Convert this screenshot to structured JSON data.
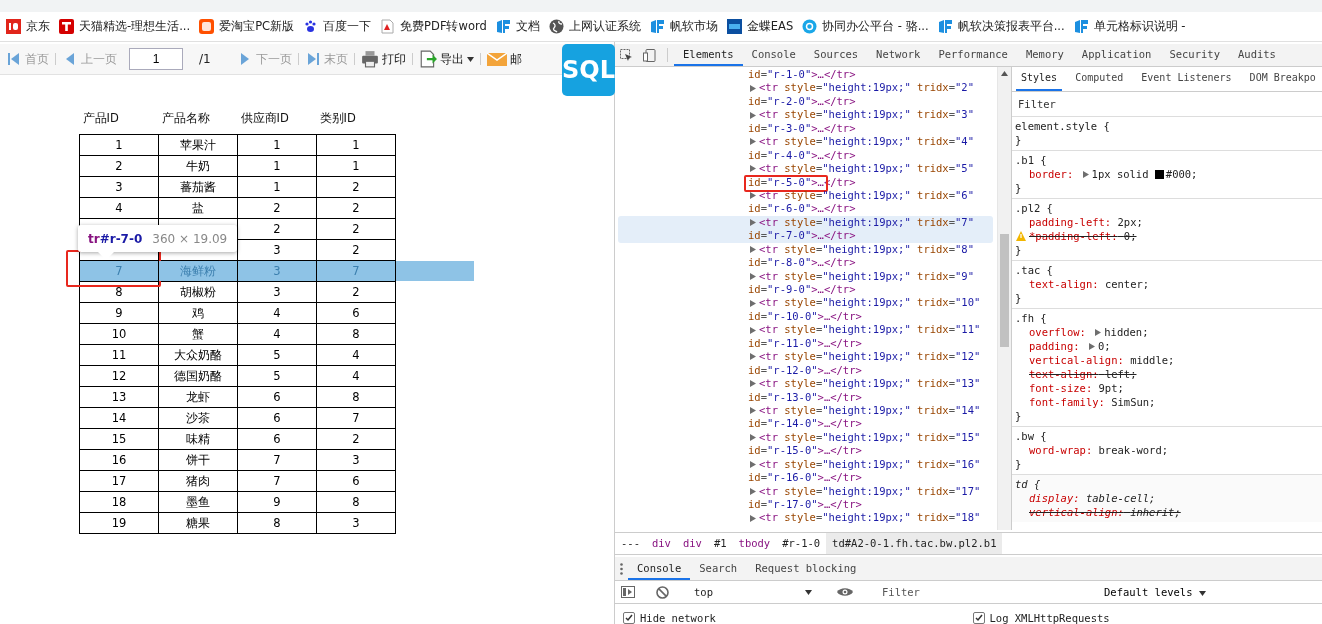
{
  "bookmarks": [
    {
      "label": "京东"
    },
    {
      "label": "天猫精选-理想生活..."
    },
    {
      "label": "爱淘宝PC新版"
    },
    {
      "label": "百度一下"
    },
    {
      "label": "免费PDF转word"
    },
    {
      "label": "文档"
    },
    {
      "label": "上网认证系统"
    },
    {
      "label": "帆软市场"
    },
    {
      "label": "金蝶EAS"
    },
    {
      "label": "协同办公平台 - 骆..."
    },
    {
      "label": "帆软决策报表平台..."
    },
    {
      "label": "单元格标识说明 -"
    }
  ],
  "report_toolbar": {
    "items": [
      {
        "kind": "button",
        "label": "首页",
        "disabled": true
      },
      {
        "kind": "button",
        "label": "上一页",
        "disabled": true
      },
      {
        "kind": "page",
        "value": "1",
        "total": "/1"
      },
      {
        "kind": "button",
        "label": "下一页",
        "disabled": true
      },
      {
        "kind": "button",
        "label": "末页",
        "disabled": true
      },
      {
        "kind": "button",
        "label": "打印",
        "disabled": false
      },
      {
        "kind": "menu",
        "label": "导出",
        "disabled": false
      },
      {
        "kind": "button",
        "label": "邮",
        "disabled": false
      }
    ]
  },
  "sql_logo": {
    "text": "SQL"
  },
  "table": {
    "columns": [
      "产品ID",
      "产品名称",
      "供应商ID",
      "类别ID"
    ],
    "rows": [
      {
        "id": "1",
        "name": "苹果汁",
        "supplier": "1",
        "category": "1",
        "selected": false,
        "boxed": false
      },
      {
        "id": "2",
        "name": "牛奶",
        "supplier": "1",
        "category": "1",
        "selected": false,
        "boxed": false
      },
      {
        "id": "3",
        "name": "蕃茄酱",
        "supplier": "1",
        "category": "2",
        "selected": false,
        "boxed": false
      },
      {
        "id": "4",
        "name": "盐",
        "supplier": "2",
        "category": "2",
        "selected": false,
        "boxed": false
      },
      {
        "supplier": "2",
        "category": "2",
        "selected": false,
        "boxed": false
      },
      {
        "supplier": "3",
        "category": "2",
        "selected": false,
        "boxed": false
      },
      {
        "id": "7",
        "name": "海鲜粉",
        "supplier": "3",
        "category": "7",
        "selected": true,
        "boxed": true
      },
      {
        "id": "8",
        "name": "胡椒粉",
        "supplier": "3",
        "category": "2",
        "selected": false,
        "boxed": false
      },
      {
        "id": "9",
        "name": "鸡",
        "supplier": "4",
        "category": "6",
        "selected": false,
        "boxed": false
      },
      {
        "id": "10",
        "name": "蟹",
        "supplier": "4",
        "category": "8",
        "selected": false,
        "boxed": false
      },
      {
        "id": "11",
        "name": "大众奶酪",
        "supplier": "5",
        "category": "4",
        "selected": false,
        "boxed": false
      },
      {
        "id": "12",
        "name": "德国奶酪",
        "supplier": "5",
        "category": "4",
        "selected": false,
        "boxed": false
      },
      {
        "id": "13",
        "name": "龙虾",
        "supplier": "6",
        "category": "8",
        "selected": false,
        "boxed": false
      },
      {
        "id": "14",
        "name": "沙茶",
        "supplier": "6",
        "category": "7",
        "selected": false,
        "boxed": false
      },
      {
        "id": "15",
        "name": "味精",
        "supplier": "6",
        "category": "2",
        "selected": false,
        "boxed": false
      },
      {
        "id": "16",
        "name": "饼干",
        "supplier": "7",
        "category": "3",
        "selected": false,
        "boxed": false
      },
      {
        "id": "17",
        "name": "猪肉",
        "supplier": "7",
        "category": "6",
        "selected": false,
        "boxed": false
      },
      {
        "id": "18",
        "name": "墨鱼",
        "supplier": "9",
        "category": "8",
        "selected": false,
        "boxed": false
      },
      {
        "id": "19",
        "name": "糖果",
        "supplier": "8",
        "category": "3",
        "selected": false,
        "boxed": false
      }
    ],
    "tooltip": {
      "tag": "tr",
      "id": "#r-7-0",
      "size": "360 × 19.09"
    }
  },
  "devtools": {
    "tabs": [
      {
        "label": "Elements",
        "selected": true
      },
      {
        "label": "Console",
        "selected": false
      },
      {
        "label": "Sources",
        "selected": false
      },
      {
        "label": "Network",
        "selected": false
      },
      {
        "label": "Performance",
        "selected": false
      },
      {
        "label": "Memory",
        "selected": false
      },
      {
        "label": "Application",
        "selected": false
      },
      {
        "label": "Security",
        "selected": false
      },
      {
        "label": "Audits",
        "selected": false
      }
    ],
    "nodes": [
      {
        "selected": false,
        "close": [
          {
            "kind": "attr",
            "text": "id"
          },
          {
            "kind": "punct",
            "text": "="
          },
          {
            "kind": "value",
            "text": "\"r-1-0\""
          },
          {
            "kind": "tag",
            "text": ">…</tr>"
          }
        ]
      },
      {
        "selected": false,
        "open": [
          {
            "kind": "tag",
            "text": "<tr"
          },
          {
            "kind": "attr",
            "text": " style"
          },
          {
            "kind": "punct",
            "text": "="
          },
          {
            "kind": "value",
            "text": "\"height:19px;\""
          },
          {
            "kind": "attr",
            "text": " tridx"
          },
          {
            "kind": "punct",
            "text": "="
          },
          {
            "kind": "value",
            "text": "\"2\""
          }
        ],
        "close": [
          {
            "kind": "attr",
            "text": "id"
          },
          {
            "kind": "punct",
            "text": "="
          },
          {
            "kind": "value",
            "text": "\"r-2-0\""
          },
          {
            "kind": "tag",
            "text": ">…</tr>"
          }
        ]
      },
      {
        "selected": false,
        "open": [
          {
            "kind": "tag",
            "text": "<tr"
          },
          {
            "kind": "attr",
            "text": " style"
          },
          {
            "kind": "punct",
            "text": "="
          },
          {
            "kind": "value",
            "text": "\"height:19px;\""
          },
          {
            "kind": "attr",
            "text": " tridx"
          },
          {
            "kind": "punct",
            "text": "="
          },
          {
            "kind": "value",
            "text": "\"3\""
          }
        ],
        "close": [
          {
            "kind": "attr",
            "text": "id"
          },
          {
            "kind": "punct",
            "text": "="
          },
          {
            "kind": "value",
            "text": "\"r-3-0\""
          },
          {
            "kind": "tag",
            "text": ">…</tr>"
          }
        ]
      },
      {
        "selected": false,
        "open": [
          {
            "kind": "tag",
            "text": "<tr"
          },
          {
            "kind": "attr",
            "text": " style"
          },
          {
            "kind": "punct",
            "text": "="
          },
          {
            "kind": "value",
            "text": "\"height:19px;\""
          },
          {
            "kind": "attr",
            "text": " tridx"
          },
          {
            "kind": "punct",
            "text": "="
          },
          {
            "kind": "value",
            "text": "\"4\""
          }
        ],
        "close": [
          {
            "kind": "attr",
            "text": "id"
          },
          {
            "kind": "punct",
            "text": "="
          },
          {
            "kind": "value",
            "text": "\"r-4-0\""
          },
          {
            "kind": "tag",
            "text": ">…</tr>"
          }
        ]
      },
      {
        "selected": false,
        "boxed": true,
        "open": [
          {
            "kind": "tag",
            "text": "<tr"
          },
          {
            "kind": "attr",
            "text": " style"
          },
          {
            "kind": "punct",
            "text": "="
          },
          {
            "kind": "value",
            "text": "\"height:19px;\""
          },
          {
            "kind": "attr",
            "text": " tridx"
          },
          {
            "kind": "punct",
            "text": "="
          },
          {
            "kind": "value",
            "text": "\"5\""
          }
        ],
        "close": [
          {
            "kind": "attr",
            "text": "id"
          },
          {
            "kind": "punct",
            "text": "="
          },
          {
            "kind": "value",
            "text": "\"r-5-0\""
          },
          {
            "kind": "tag",
            "text": ">…</tr>"
          }
        ]
      },
      {
        "selected": false,
        "open": [
          {
            "kind": "tag",
            "text": "<tr"
          },
          {
            "kind": "attr",
            "text": " style"
          },
          {
            "kind": "punct",
            "text": "="
          },
          {
            "kind": "value",
            "text": "\"height:19px;\""
          },
          {
            "kind": "attr",
            "text": " tridx"
          },
          {
            "kind": "punct",
            "text": "="
          },
          {
            "kind": "value",
            "text": "\"6\""
          }
        ],
        "close": [
          {
            "kind": "attr",
            "text": "id"
          },
          {
            "kind": "punct",
            "text": "="
          },
          {
            "kind": "value",
            "text": "\"r-6-0\""
          },
          {
            "kind": "tag",
            "text": ">…</tr>"
          }
        ]
      },
      {
        "selected": true,
        "open": [
          {
            "kind": "tag",
            "text": "<tr"
          },
          {
            "kind": "attr",
            "text": " style"
          },
          {
            "kind": "punct",
            "text": "="
          },
          {
            "kind": "value",
            "text": "\"height:19px;\""
          },
          {
            "kind": "attr",
            "text": " tridx"
          },
          {
            "kind": "punct",
            "text": "="
          },
          {
            "kind": "value",
            "text": "\"7\""
          }
        ],
        "close": [
          {
            "kind": "attr",
            "text": "id"
          },
          {
            "kind": "punct",
            "text": "="
          },
          {
            "kind": "value",
            "text": "\"r-7-0\""
          },
          {
            "kind": "tag",
            "text": ">…</tr>"
          }
        ]
      },
      {
        "selected": false,
        "open": [
          {
            "kind": "tag",
            "text": "<tr"
          },
          {
            "kind": "attr",
            "text": " style"
          },
          {
            "kind": "punct",
            "text": "="
          },
          {
            "kind": "value",
            "text": "\"height:19px;\""
          },
          {
            "kind": "attr",
            "text": " tridx"
          },
          {
            "kind": "punct",
            "text": "="
          },
          {
            "kind": "value",
            "text": "\"8\""
          }
        ],
        "close": [
          {
            "kind": "attr",
            "text": "id"
          },
          {
            "kind": "punct",
            "text": "="
          },
          {
            "kind": "value",
            "text": "\"r-8-0\""
          },
          {
            "kind": "tag",
            "text": ">…</tr>"
          }
        ]
      },
      {
        "selected": false,
        "open": [
          {
            "kind": "tag",
            "text": "<tr"
          },
          {
            "kind": "attr",
            "text": " style"
          },
          {
            "kind": "punct",
            "text": "="
          },
          {
            "kind": "value",
            "text": "\"height:19px;\""
          },
          {
            "kind": "attr",
            "text": " tridx"
          },
          {
            "kind": "punct",
            "text": "="
          },
          {
            "kind": "value",
            "text": "\"9\""
          }
        ],
        "close": [
          {
            "kind": "attr",
            "text": "id"
          },
          {
            "kind": "punct",
            "text": "="
          },
          {
            "kind": "value",
            "text": "\"r-9-0\""
          },
          {
            "kind": "tag",
            "text": ">…</tr>"
          }
        ]
      },
      {
        "selected": false,
        "open": [
          {
            "kind": "tag",
            "text": "<tr"
          },
          {
            "kind": "attr",
            "text": " style"
          },
          {
            "kind": "punct",
            "text": "="
          },
          {
            "kind": "value",
            "text": "\"height:19px;\""
          },
          {
            "kind": "attr",
            "text": " tridx"
          },
          {
            "kind": "punct",
            "text": "="
          },
          {
            "kind": "value",
            "text": "\"10\""
          }
        ],
        "close": [
          {
            "kind": "attr",
            "text": "id"
          },
          {
            "kind": "punct",
            "text": "="
          },
          {
            "kind": "value",
            "text": "\"r-10-0\""
          },
          {
            "kind": "tag",
            "text": ">…</tr>"
          }
        ]
      },
      {
        "selected": false,
        "open": [
          {
            "kind": "tag",
            "text": "<tr"
          },
          {
            "kind": "attr",
            "text": " style"
          },
          {
            "kind": "punct",
            "text": "="
          },
          {
            "kind": "value",
            "text": "\"height:19px;\""
          },
          {
            "kind": "attr",
            "text": " tridx"
          },
          {
            "kind": "punct",
            "text": "="
          },
          {
            "kind": "value",
            "text": "\"11\""
          }
        ],
        "close": [
          {
            "kind": "attr",
            "text": "id"
          },
          {
            "kind": "punct",
            "text": "="
          },
          {
            "kind": "value",
            "text": "\"r-11-0\""
          },
          {
            "kind": "tag",
            "text": ">…</tr>"
          }
        ]
      },
      {
        "selected": false,
        "open": [
          {
            "kind": "tag",
            "text": "<tr"
          },
          {
            "kind": "attr",
            "text": " style"
          },
          {
            "kind": "punct",
            "text": "="
          },
          {
            "kind": "value",
            "text": "\"height:19px;\""
          },
          {
            "kind": "attr",
            "text": " tridx"
          },
          {
            "kind": "punct",
            "text": "="
          },
          {
            "kind": "value",
            "text": "\"12\""
          }
        ],
        "close": [
          {
            "kind": "attr",
            "text": "id"
          },
          {
            "kind": "punct",
            "text": "="
          },
          {
            "kind": "value",
            "text": "\"r-12-0\""
          },
          {
            "kind": "tag",
            "text": ">…</tr>"
          }
        ]
      },
      {
        "selected": false,
        "open": [
          {
            "kind": "tag",
            "text": "<tr"
          },
          {
            "kind": "attr",
            "text": " style"
          },
          {
            "kind": "punct",
            "text": "="
          },
          {
            "kind": "value",
            "text": "\"height:19px;\""
          },
          {
            "kind": "attr",
            "text": " tridx"
          },
          {
            "kind": "punct",
            "text": "="
          },
          {
            "kind": "value",
            "text": "\"13\""
          }
        ],
        "close": [
          {
            "kind": "attr",
            "text": "id"
          },
          {
            "kind": "punct",
            "text": "="
          },
          {
            "kind": "value",
            "text": "\"r-13-0\""
          },
          {
            "kind": "tag",
            "text": ">…</tr>"
          }
        ]
      },
      {
        "selected": false,
        "open": [
          {
            "kind": "tag",
            "text": "<tr"
          },
          {
            "kind": "attr",
            "text": " style"
          },
          {
            "kind": "punct",
            "text": "="
          },
          {
            "kind": "value",
            "text": "\"height:19px;\""
          },
          {
            "kind": "attr",
            "text": " tridx"
          },
          {
            "kind": "punct",
            "text": "="
          },
          {
            "kind": "value",
            "text": "\"14\""
          }
        ],
        "close": [
          {
            "kind": "attr",
            "text": "id"
          },
          {
            "kind": "punct",
            "text": "="
          },
          {
            "kind": "value",
            "text": "\"r-14-0\""
          },
          {
            "kind": "tag",
            "text": ">…</tr>"
          }
        ]
      },
      {
        "selected": false,
        "open": [
          {
            "kind": "tag",
            "text": "<tr"
          },
          {
            "kind": "attr",
            "text": " style"
          },
          {
            "kind": "punct",
            "text": "="
          },
          {
            "kind": "value",
            "text": "\"height:19px;\""
          },
          {
            "kind": "attr",
            "text": " tridx"
          },
          {
            "kind": "punct",
            "text": "="
          },
          {
            "kind": "value",
            "text": "\"15\""
          }
        ],
        "close": [
          {
            "kind": "attr",
            "text": "id"
          },
          {
            "kind": "punct",
            "text": "="
          },
          {
            "kind": "value",
            "text": "\"r-15-0\""
          },
          {
            "kind": "tag",
            "text": ">…</tr>"
          }
        ]
      },
      {
        "selected": false,
        "open": [
          {
            "kind": "tag",
            "text": "<tr"
          },
          {
            "kind": "attr",
            "text": " style"
          },
          {
            "kind": "punct",
            "text": "="
          },
          {
            "kind": "value",
            "text": "\"height:19px;\""
          },
          {
            "kind": "attr",
            "text": " tridx"
          },
          {
            "kind": "punct",
            "text": "="
          },
          {
            "kind": "value",
            "text": "\"16\""
          }
        ],
        "close": [
          {
            "kind": "attr",
            "text": "id"
          },
          {
            "kind": "punct",
            "text": "="
          },
          {
            "kind": "value",
            "text": "\"r-16-0\""
          },
          {
            "kind": "tag",
            "text": ">…</tr>"
          }
        ]
      },
      {
        "selected": false,
        "open": [
          {
            "kind": "tag",
            "text": "<tr"
          },
          {
            "kind": "attr",
            "text": " style"
          },
          {
            "kind": "punct",
            "text": "="
          },
          {
            "kind": "value",
            "text": "\"height:19px;\""
          },
          {
            "kind": "attr",
            "text": " tridx"
          },
          {
            "kind": "punct",
            "text": "="
          },
          {
            "kind": "value",
            "text": "\"17\""
          }
        ],
        "close": [
          {
            "kind": "attr",
            "text": "id"
          },
          {
            "kind": "punct",
            "text": "="
          },
          {
            "kind": "value",
            "text": "\"r-17-0\""
          },
          {
            "kind": "tag",
            "text": ">…</tr>"
          }
        ]
      },
      {
        "selected": false,
        "open": [
          {
            "kind": "tag",
            "text": "<tr"
          },
          {
            "kind": "attr",
            "text": " style"
          },
          {
            "kind": "punct",
            "text": "="
          },
          {
            "kind": "value",
            "text": "\"height:19px;\""
          },
          {
            "kind": "attr",
            "text": " tridx"
          },
          {
            "kind": "punct",
            "text": "="
          },
          {
            "kind": "value",
            "text": "\"18\""
          }
        ]
      }
    ],
    "styles_tabs": [
      {
        "label": "Styles",
        "selected": true
      },
      {
        "label": "Computed",
        "selected": false
      },
      {
        "label": "Event Listeners",
        "selected": false
      },
      {
        "label": "DOM Breakpo",
        "selected": false
      }
    ],
    "styles_filter": {
      "placeholder": "Filter"
    },
    "rules": [
      {
        "selector": "element.style {",
        "italic": false,
        "close": "}"
      },
      {
        "selector": ".b1 {",
        "italic": false,
        "declarations": [
          {
            "name": "border:",
            "value": "1px solid",
            "color": "#000000",
            "swatch_text": "#000;",
            "expandable": true,
            "overridden": false,
            "warning": false
          }
        ],
        "close": "}"
      },
      {
        "selector": ".pl2 {",
        "italic": false,
        "declarations": [
          {
            "name": "padding-left:",
            "value": "2px;",
            "expandable": false,
            "overridden": false,
            "warning": false
          },
          {
            "name": "*padding-left:",
            "value": "0;",
            "expandable": false,
            "overridden": true,
            "warning": true
          }
        ],
        "close": "}"
      },
      {
        "selector": ".tac {",
        "italic": false,
        "declarations": [
          {
            "name": "text-align:",
            "value": "center;",
            "expandable": false,
            "overridden": false,
            "warning": false
          }
        ],
        "close": "}"
      },
      {
        "selector": ".fh {",
        "italic": false,
        "declarations": [
          {
            "name": "overflow:",
            "value": "hidden;",
            "expandable": true,
            "overridden": false,
            "warning": false
          },
          {
            "name": "padding:",
            "value": "0;",
            "expandable": true,
            "overridden": false,
            "warning": false
          },
          {
            "name": "vertical-align:",
            "value": "middle;",
            "expandable": false,
            "overridden": false,
            "warning": false
          },
          {
            "name": "text-align:",
            "value": "left;",
            "expandable": false,
            "overridden": true,
            "warning": false
          },
          {
            "name": "font-size:",
            "value": "9pt;",
            "expandable": false,
            "overridden": false,
            "warning": false
          },
          {
            "name": "font-family:",
            "value": "SimSun;",
            "expandable": false,
            "overridden": false,
            "warning": false
          }
        ],
        "close": "}"
      },
      {
        "selector": ".bw {",
        "italic": false,
        "declarations": [
          {
            "name": "word-wrap:",
            "value": "break-word;",
            "expandable": false,
            "overridden": false,
            "warning": false
          }
        ],
        "close": "}"
      },
      {
        "selector": "td {",
        "italic": true,
        "declarations": [
          {
            "name": "display:",
            "value": "table-cell;",
            "expandable": false,
            "overridden": false,
            "warning": false
          },
          {
            "name": "vertical-align:",
            "value": "inherit;",
            "expandable": false,
            "overridden": true,
            "warning": false
          }
        ]
      }
    ],
    "breadcrumbs": [
      {
        "text": "---",
        "kind": "more",
        "selected": false
      },
      {
        "text": "div",
        "kind": "tag",
        "selected": false
      },
      {
        "text": "div",
        "kind": "tag",
        "selected": false
      },
      {
        "text": "#1",
        "kind": "id",
        "selected": false
      },
      {
        "text": "tbody",
        "kind": "tag",
        "selected": false
      },
      {
        "text": "#r-1-0",
        "kind": "id",
        "selected": false
      },
      {
        "text": "td#A2-0-1.fh.tac.bw.pl2.b1",
        "kind": "id",
        "selected": true
      }
    ],
    "drawer_tabs": [
      {
        "label": "Console",
        "selected": true
      },
      {
        "label": "Search",
        "selected": false
      },
      {
        "label": "Request blocking",
        "selected": false
      }
    ],
    "console_toolbar": {
      "context": "top",
      "filter_placeholder": "Filter",
      "levels": "Default levels"
    },
    "console_settings": [
      {
        "label": "Hide network",
        "checked": true
      },
      {
        "label": "Log XMLHttpRequests",
        "checked": true
      }
    ]
  }
}
